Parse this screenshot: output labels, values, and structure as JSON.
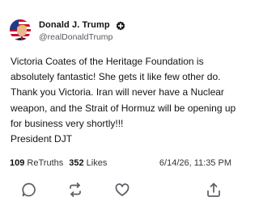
{
  "author": {
    "display_name": "Donald J. Trump",
    "handle": "@realDonaldTrump",
    "avatar_icon": "profile-avatar-flag",
    "verified_icon": "verified-badge-icon"
  },
  "post": {
    "text": "Victoria Coates of the Heritage Foundation is absolutely fantastic! She gets it like few other do. Thank you Victoria. Iran will never have a Nuclear weapon, and the Strait of Hormuz will be opening up for business very shortly!!!\nPresident DJT"
  },
  "stats": {
    "retruths_count": "109",
    "retruths_label": "ReTruths",
    "likes_count": "352",
    "likes_label": "Likes",
    "timestamp": "6/14/26, 11:35 PM"
  },
  "actions": [
    {
      "icon": "reply-icon"
    },
    {
      "icon": "retruth-icon"
    },
    {
      "icon": "like-icon"
    },
    {
      "icon": "share-icon"
    }
  ],
  "colors": {
    "text": "#111111",
    "secondary_text": "#555a60",
    "icon": "#5a5f66"
  }
}
